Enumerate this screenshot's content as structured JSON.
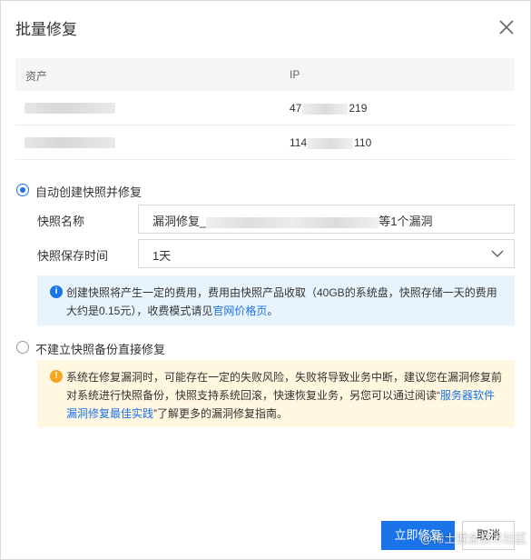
{
  "dialog": {
    "title": "批量修复",
    "close_icon": "close-icon"
  },
  "table": {
    "columns": [
      "资产",
      "IP"
    ],
    "rows": [
      {
        "ip_prefix": "47",
        "ip_suffix": "219"
      },
      {
        "ip_prefix": "114",
        "ip_suffix": "110"
      }
    ]
  },
  "option_snapshot": {
    "label": "自动创建快照并修复",
    "checked": true,
    "name_label": "快照名称",
    "name_value_prefix": "漏洞修复_",
    "name_value_suffix": "等1个漏洞",
    "retention_label": "快照保存时间",
    "retention_value": "1天",
    "info_text": "创建快照将产生一定的费用，费用由快照产品收取（40GB的系统盘，快照存储一天的费用大约是0.15元），收费模式请见",
    "info_link": "官网价格页",
    "info_end": "。"
  },
  "option_direct": {
    "label": "不建立快照备份直接修复",
    "checked": false,
    "warn_text": "系统在修复漏洞时，可能存在一定的失败风险，失败将导致业务中断，建议您在漏洞修复前对系统进行快照备份，快照支持系统回滚，快速恢复业务，另您可以通过阅读“",
    "warn_link": "服务器软件漏洞修复最佳实践",
    "warn_end": "”了解更多的漏洞修复指南。"
  },
  "footer": {
    "confirm_label": "立即修复",
    "cancel_label": "取消"
  },
  "watermark": "@稀土掘金技术社区",
  "colors": {
    "primary": "#1a73e8",
    "info_bg": "#e8f4fd",
    "warn_bg": "#fff7e0",
    "warn_icon": "#f5a623"
  }
}
